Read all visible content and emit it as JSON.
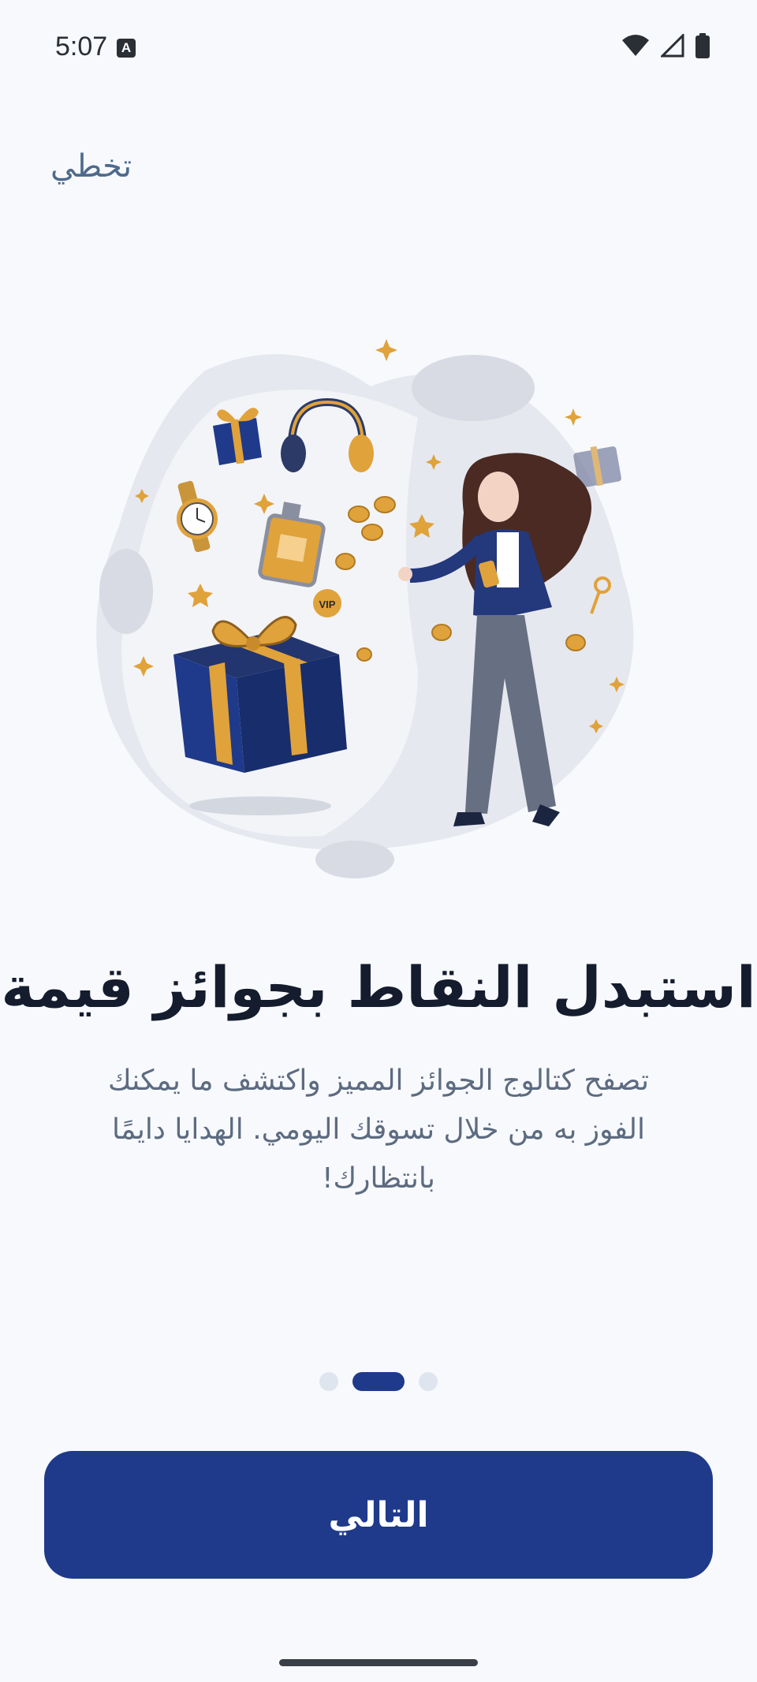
{
  "status_bar": {
    "time": "5:07",
    "notification_letter": "A",
    "icons": [
      "wifi-icon",
      "signal-icon",
      "battery-icon"
    ]
  },
  "header": {
    "skip_label": "تخطي"
  },
  "illustration": {
    "badge_text": "VIP"
  },
  "content": {
    "title": "استبدل النقاط بجوائز قيمة",
    "description": "تصفح كتالوج الجوائز المميز واكتشف ما يمكنك الفوز به من خلال تسوقك اليومي. الهدايا دايمًا بانتظارك!"
  },
  "pagination": {
    "total": 3,
    "active_index": 1
  },
  "footer": {
    "next_label": "التالي"
  },
  "colors": {
    "primary": "#1f3a8a",
    "background": "#f7f9fc",
    "gold": "#e0a23a",
    "text_secondary": "#5d6b80"
  }
}
